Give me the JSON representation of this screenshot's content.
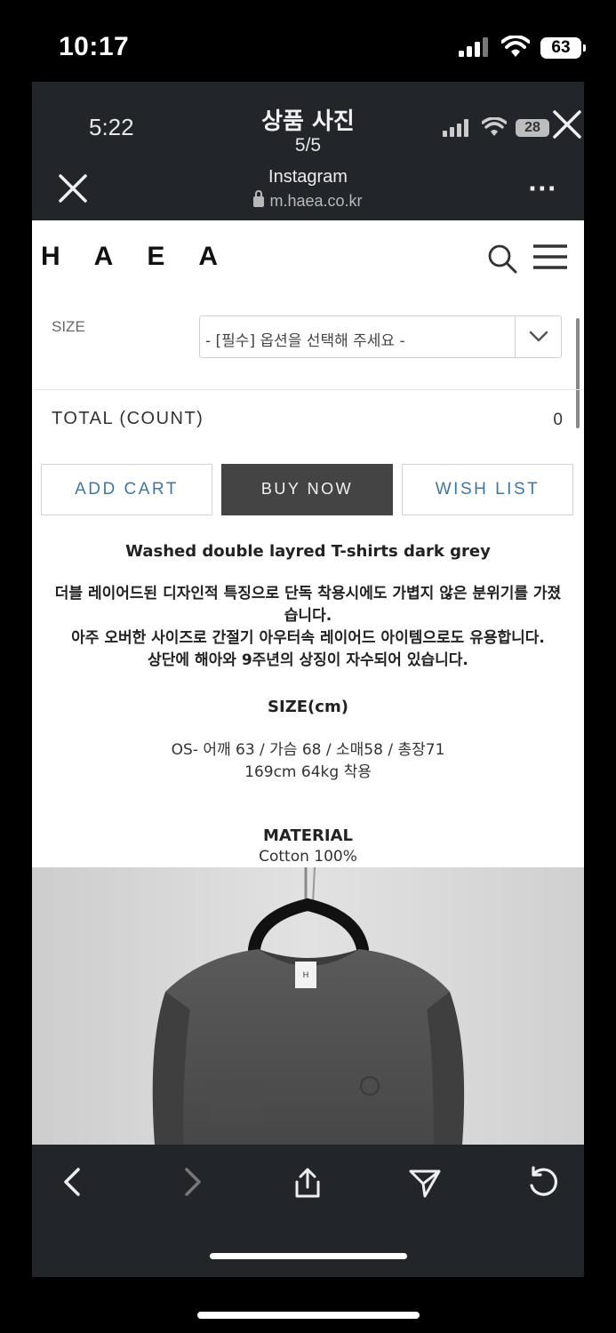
{
  "outer_status": {
    "time": "10:17",
    "battery": "63"
  },
  "viewer": {
    "time": "5:22",
    "title": "상품 사진",
    "count": "5/5",
    "battery": "28",
    "site_name": "Instagram",
    "site_url": "m.haea.co.kr",
    "more": "···"
  },
  "page": {
    "logo": "HAEA",
    "size_label": "SIZE",
    "size_select_value": "- [필수] 옵션을 선택해 주세요 -",
    "total_label": "TOTAL (COUNT)",
    "total_value": "0",
    "buttons": {
      "add_cart": "ADD CART",
      "buy_now": "BUY NOW",
      "wish_list": "WISH LIST"
    },
    "product_title": "Washed double layred T-shirts dark grey",
    "description": [
      "더블 레이어드된 디자인적 특징으로 단독 착용시에도 가볍지 않은 분위기를 가졌",
      "습니다.",
      "아주 오버한 사이즈로 간절기 아우터속 레이어드 아이템으로도 유용합니다.",
      "상단에 해아와 9주년의 상징이 자수되어 있습니다."
    ],
    "size_heading": "SIZE(cm)",
    "size_spec": [
      "OS- 어깨 63 / 가슴 68 / 소매58 / 총장71",
      "169cm 64kg 착용"
    ],
    "material_heading": "MATERIAL",
    "material_spec": "Cotton 100%",
    "photo_label": "H"
  },
  "toolbar": {
    "icons": [
      "back-icon",
      "forward-icon",
      "share-icon",
      "send-icon",
      "refresh-icon"
    ]
  },
  "colors": {
    "frame_bg": "#22262b",
    "button_accent": "#3b78a8",
    "buy_now_bg": "#444444"
  }
}
